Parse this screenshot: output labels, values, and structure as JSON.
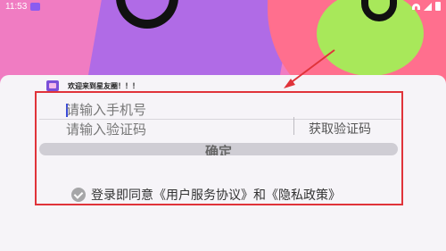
{
  "statusbar": {
    "time": "11:53",
    "icons": [
      "app-badge-icon",
      "wifi-icon",
      "signal-icon",
      "battery-icon"
    ]
  },
  "sheet": {
    "welcome": "欢迎来到星友圈！！！",
    "phone_placeholder": "请输入手机号",
    "code_placeholder": "请输入验证码",
    "get_code_label": "获取验证码",
    "confirm_label": "确定",
    "agree_prefix": "登录即同意",
    "user_agreement": "《用户服务协议》",
    "and": "和",
    "privacy_policy": "《隐私政策》"
  },
  "colors": {
    "annotation": "#e0333a",
    "accent_cursor": "#3b4bd8",
    "background_pink": "#f07cc2",
    "background_purple": "#b06be6",
    "background_lime": "#a8e85a"
  }
}
